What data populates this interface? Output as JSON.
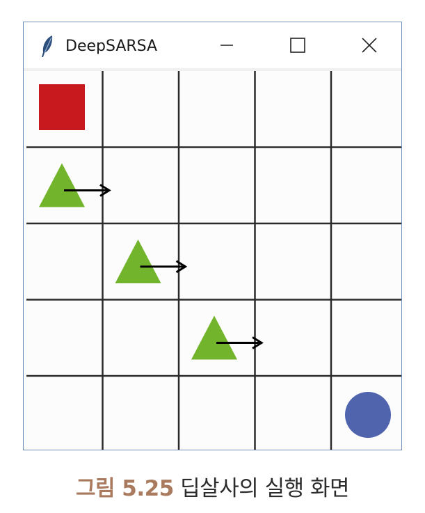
{
  "window": {
    "title": "DeepSARSA",
    "icon": "feather-icon",
    "controls": [
      "minimize-icon",
      "maximize-icon",
      "close-icon"
    ]
  },
  "grid": {
    "rows": 5,
    "cols": 5,
    "line_color": "#2a2a2a",
    "cells": [
      {
        "row": 0,
        "col": 0,
        "type": "rectangle",
        "color": "#c8191f"
      },
      {
        "row": 1,
        "col": 0,
        "type": "triangle",
        "color": "#72b42b",
        "arrow": "right"
      },
      {
        "row": 2,
        "col": 1,
        "type": "triangle",
        "color": "#72b42b",
        "arrow": "right"
      },
      {
        "row": 3,
        "col": 2,
        "type": "triangle",
        "color": "#72b42b",
        "arrow": "right"
      },
      {
        "row": 4,
        "col": 4,
        "type": "circle",
        "color": "#5064ae"
      }
    ]
  },
  "caption": {
    "label": "그림 5.25",
    "text": "딥살사의 실행 화면"
  }
}
